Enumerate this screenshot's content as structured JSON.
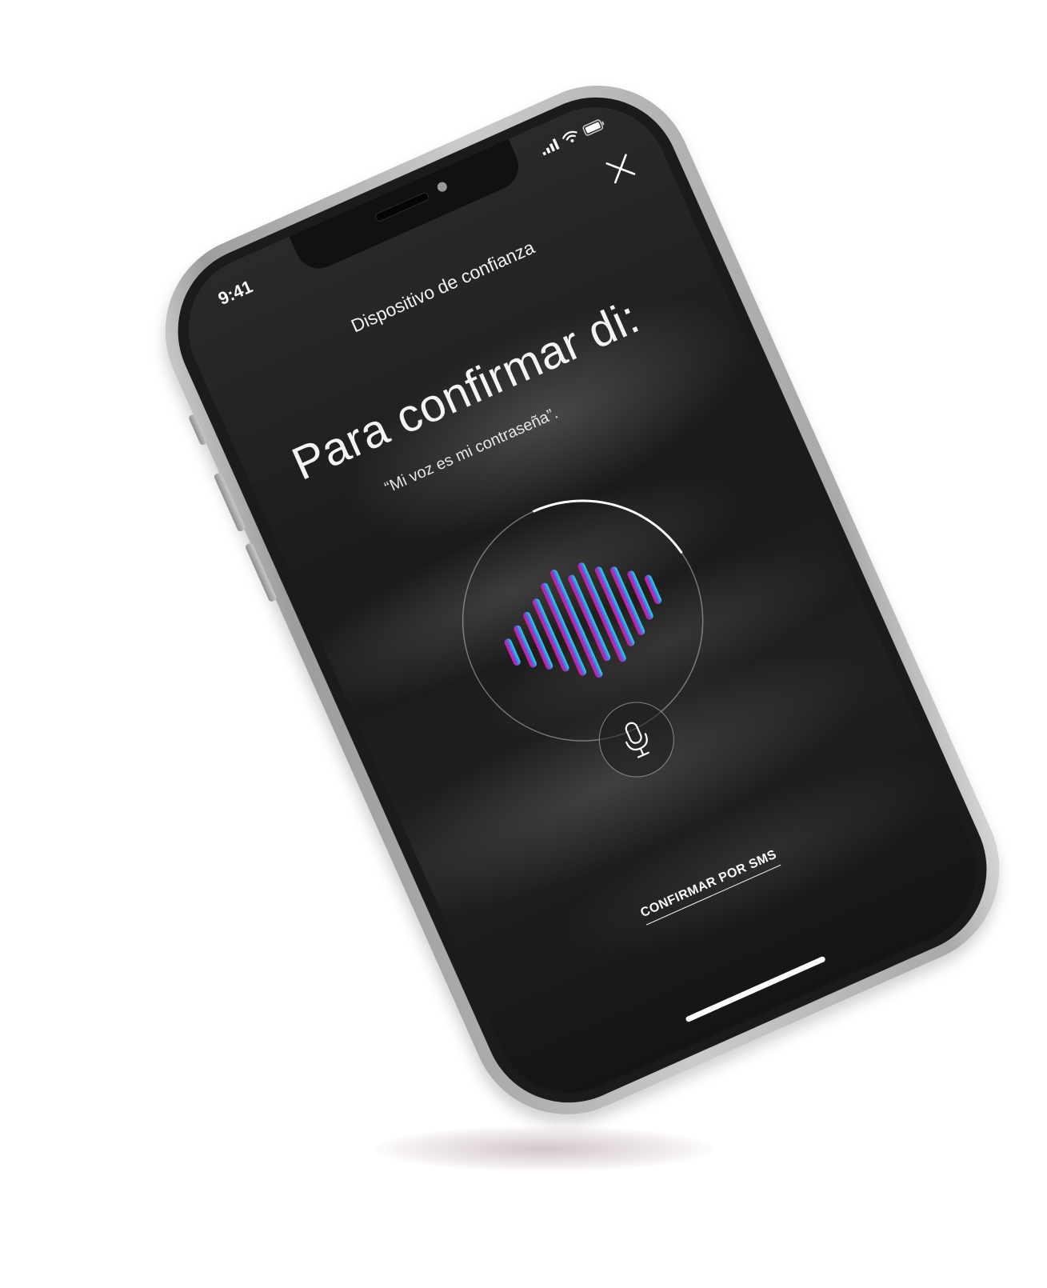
{
  "status_bar": {
    "time": "9:41",
    "icons": [
      "cellular-signal-icon",
      "wifi-icon",
      "battery-icon"
    ]
  },
  "header": {
    "title": "Dispositivo de confianza",
    "close_icon": "close-icon"
  },
  "voice_confirm": {
    "title": "Para confirmar di:",
    "phrase": "“Mi voz es mi contraseña”.",
    "progress_fraction": 0.22,
    "mic_icon": "microphone-icon",
    "waveform_gradient": [
      "#e6197a",
      "#8a3ad6",
      "#3e8ee8",
      "#1fe5dc"
    ],
    "waveform_levels": [
      0.24,
      0.38,
      0.52,
      0.66,
      0.84,
      0.98,
      0.78,
      0.9,
      0.72,
      0.62,
      0.44,
      0.26
    ]
  },
  "footer": {
    "sms_link": "CONFIRMAR POR SMS"
  }
}
